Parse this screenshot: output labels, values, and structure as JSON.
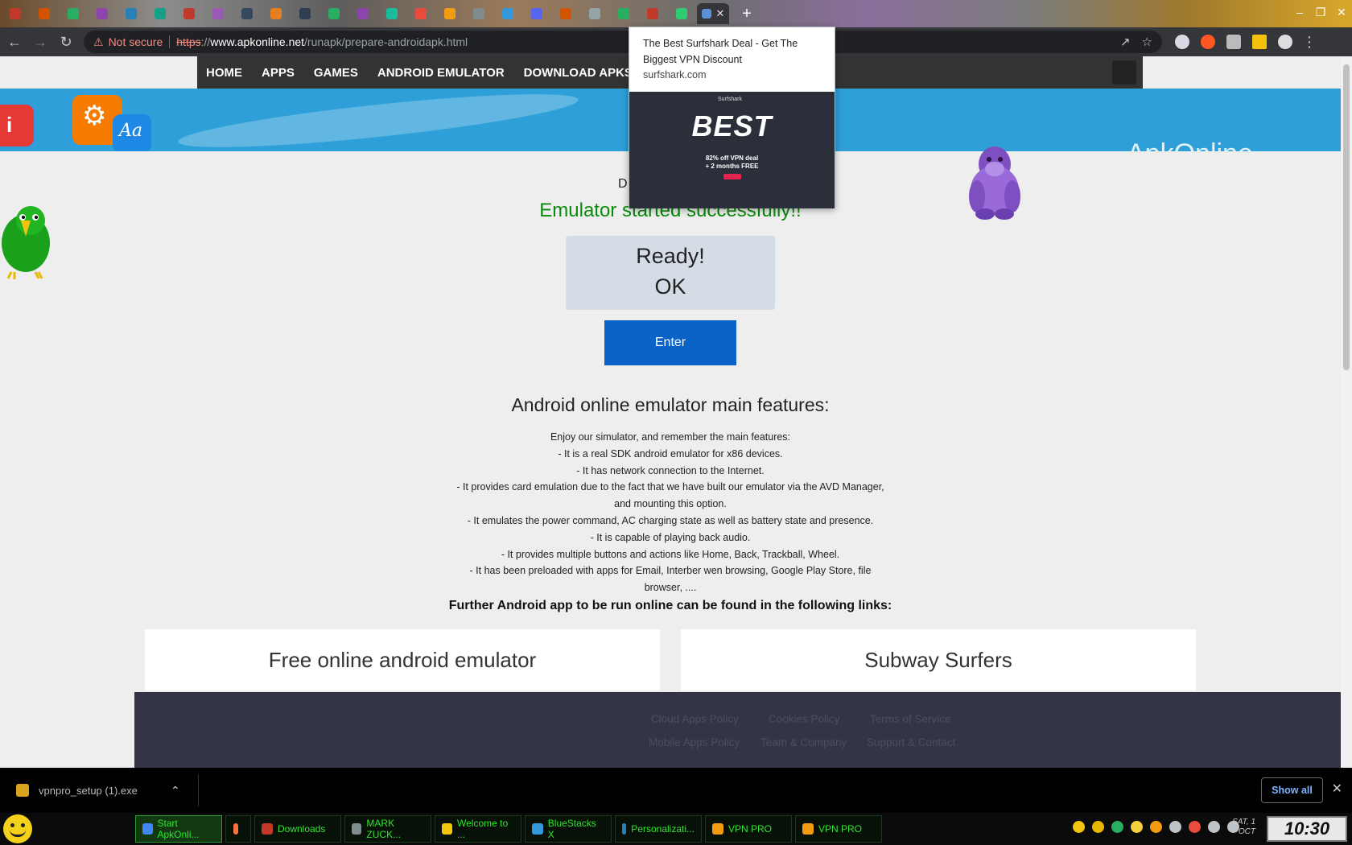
{
  "browser": {
    "tabs": [
      {
        "color": "#c0392b"
      },
      {
        "color": "#d35400"
      },
      {
        "color": "#27ae60"
      },
      {
        "color": "#8e44ad"
      },
      {
        "color": "#2980b9"
      },
      {
        "color": "#16a085"
      },
      {
        "color": "#c0392b"
      },
      {
        "color": "#9b59b6"
      },
      {
        "color": "#34495e"
      },
      {
        "color": "#e67e22"
      },
      {
        "color": "#2c3e50"
      },
      {
        "color": "#27ae60"
      },
      {
        "color": "#8e44ad"
      },
      {
        "color": "#1abc9c"
      },
      {
        "color": "#e74c3c"
      },
      {
        "color": "#f39c12"
      },
      {
        "color": "#7f8c8d"
      },
      {
        "color": "#3498db"
      },
      {
        "color": "#5865f2"
      },
      {
        "color": "#d35400"
      },
      {
        "color": "#95a5a6"
      },
      {
        "color": "#27ae60"
      },
      {
        "color": "#c0392b"
      },
      {
        "color": "#2ecc71"
      }
    ],
    "active_tab_close": "✕",
    "new_tab": "+",
    "window_controls": [
      "–",
      "❐",
      "✕"
    ],
    "security_label": "Not secure",
    "url_scheme": "https",
    "url_sep": "://",
    "url_host": "www.apkonline.net",
    "url_path": "/runapk/prepare-androidapk.html"
  },
  "site": {
    "nav": [
      "HOME",
      "APPS",
      "GAMES",
      "ANDROID EMULATOR",
      "DOWNLOAD APKS"
    ],
    "banner_text": "ApkOnline",
    "title_partial": "D",
    "status_message": "Emulator started successfully!!",
    "status_box": {
      "line1": "Ready!",
      "line2": "OK"
    },
    "enter_button": "Enter",
    "features_heading": "Android online emulator main features:",
    "features_lines": [
      "Enjoy our simulator, and remember the main features:",
      "- It is a real SDK android emulator for x86 devices.",
      "- It has network connection to the Internet.",
      "- It provides card emulation due to the fact that we have built our emulator via the AVD Manager, and mounting this option.",
      "- It emulates the power command, AC charging state as well as battery state and presence.",
      "- It is capable of playing back audio.",
      "- It provides multiple buttons and actions like Home, Back, Trackball, Wheel.",
      "- It has been preloaded with apps for Email, Interber wen browsing, Google Play Store, file browser, ...."
    ],
    "links_heading": "Further Android app to be run online can be found in the following links:",
    "cards": [
      "Free online android emulator",
      "Subway Surfers"
    ],
    "footer_links": [
      "Cloud Apps Policy",
      "Cookies Policy",
      "Terms of Service",
      "Mobile Apps Policy",
      "Team & Company",
      "Support & Contact"
    ]
  },
  "ad": {
    "title": "The Best Surfshark Deal - Get The Biggest VPN Discount",
    "domain": "surfshark.com",
    "brand": "Surfshark",
    "headline": "BEST",
    "deal_line1": "82% off VPN deal",
    "deal_line2": "+ 2 months FREE"
  },
  "download": {
    "filename": "vpnpro_setup (1).exe",
    "show_all": "Show all"
  },
  "taskbar": {
    "tasks": [
      {
        "label": "Start ApkOnli...",
        "color": "#4285f4",
        "active": true
      },
      {
        "label": "",
        "color": "#ff7139",
        "active": false
      },
      {
        "label": "Downloads",
        "color": "#c0392b",
        "active": false
      },
      {
        "label": "MARK ZUCK...",
        "color": "#7f8c8d",
        "active": false
      },
      {
        "label": "Welcome to ...",
        "color": "#f1c40f",
        "active": false
      },
      {
        "label": "BlueStacks X",
        "color": "#3498db",
        "active": false
      },
      {
        "label": "Personalizati...",
        "color": "#2980b9",
        "active": false
      },
      {
        "label": "VPN PRO",
        "color": "#f39c12",
        "active": false
      },
      {
        "label": "VPN PRO",
        "color": "#f39c12",
        "active": false
      }
    ],
    "tray_colors": [
      "#f1c40f",
      "#e6b800",
      "#27ae60",
      "#f4d03f",
      "#f39c12",
      "#bdc3c7",
      "#e74c3c",
      "#bdc3c7",
      "#bdc3c7"
    ],
    "date_day": "SAT, 1",
    "date_month": "OCT",
    "clock": "10:30"
  }
}
